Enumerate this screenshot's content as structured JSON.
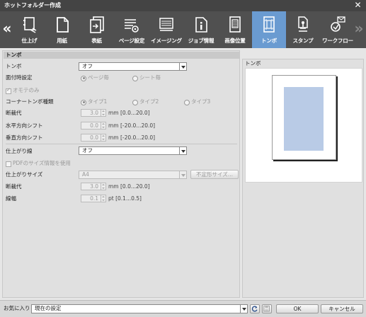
{
  "window": {
    "title": "ホットフォルダー作成"
  },
  "toolbar": {
    "items": [
      {
        "label": "仕上げ",
        "icon": "finishing-icon"
      },
      {
        "label": "用紙",
        "icon": "paper-icon"
      },
      {
        "label": "表紙",
        "icon": "cover-icon"
      },
      {
        "label": "ページ設定",
        "icon": "page-settings-icon"
      },
      {
        "label": "イメージング",
        "icon": "imaging-icon"
      },
      {
        "label": "ジョブ情報",
        "icon": "job-info-icon"
      },
      {
        "label": "画像位置",
        "icon": "image-position-icon"
      },
      {
        "label": "トンボ",
        "icon": "crop-marks-icon"
      },
      {
        "label": "スタンプ",
        "icon": "stamp-icon"
      },
      {
        "label": "ワークフロー",
        "icon": "workflow-icon"
      }
    ],
    "active_index": 7,
    "colors": {
      "bar": "#505050",
      "active": "#6a9bd1"
    }
  },
  "section": {
    "title": "トンボ"
  },
  "form": {
    "tombo": {
      "label": "トンボ",
      "value": "オフ"
    },
    "face_setting": {
      "label": "面付時設定",
      "options": [
        "ページ毎",
        "シート毎"
      ],
      "selected": 0
    },
    "omote_only": {
      "label": "オモテのみ",
      "checked": true
    },
    "corner_type": {
      "label": "コーナートンボ種類",
      "options": [
        "タイプ1",
        "タイプ2",
        "タイプ3"
      ],
      "selected": 0
    },
    "bleed": {
      "label": "断裁代",
      "value": "3.0",
      "unit": "mm [0.0...20.0]"
    },
    "h_shift": {
      "label": "水平方向シフト",
      "value": "0.0",
      "unit": "mm [-20.0...20.0]"
    },
    "v_shift": {
      "label": "垂直方向シフト",
      "value": "0.0",
      "unit": "mm [-20.0...20.0]"
    },
    "trim_line": {
      "label": "仕上がり線",
      "value": "オフ"
    },
    "pdf_size": {
      "label": "PDFのサイズ情報を使用",
      "checked": false
    },
    "finish_size": {
      "label": "仕上がりサイズ",
      "value": "A4",
      "button": "不定形サイズ..."
    },
    "bleed2": {
      "label": "断裁代",
      "value": "3.0",
      "unit": "mm [0.0...20.0]"
    },
    "line_width": {
      "label": "線幅",
      "value": "0.1",
      "unit": "pt [0.1...0.5]"
    }
  },
  "preview": {
    "title": "トンボ"
  },
  "footer": {
    "favorites_label": "お気に入り",
    "favorites_value": "現在の設定",
    "ok": "OK",
    "cancel": "キャンセル"
  }
}
